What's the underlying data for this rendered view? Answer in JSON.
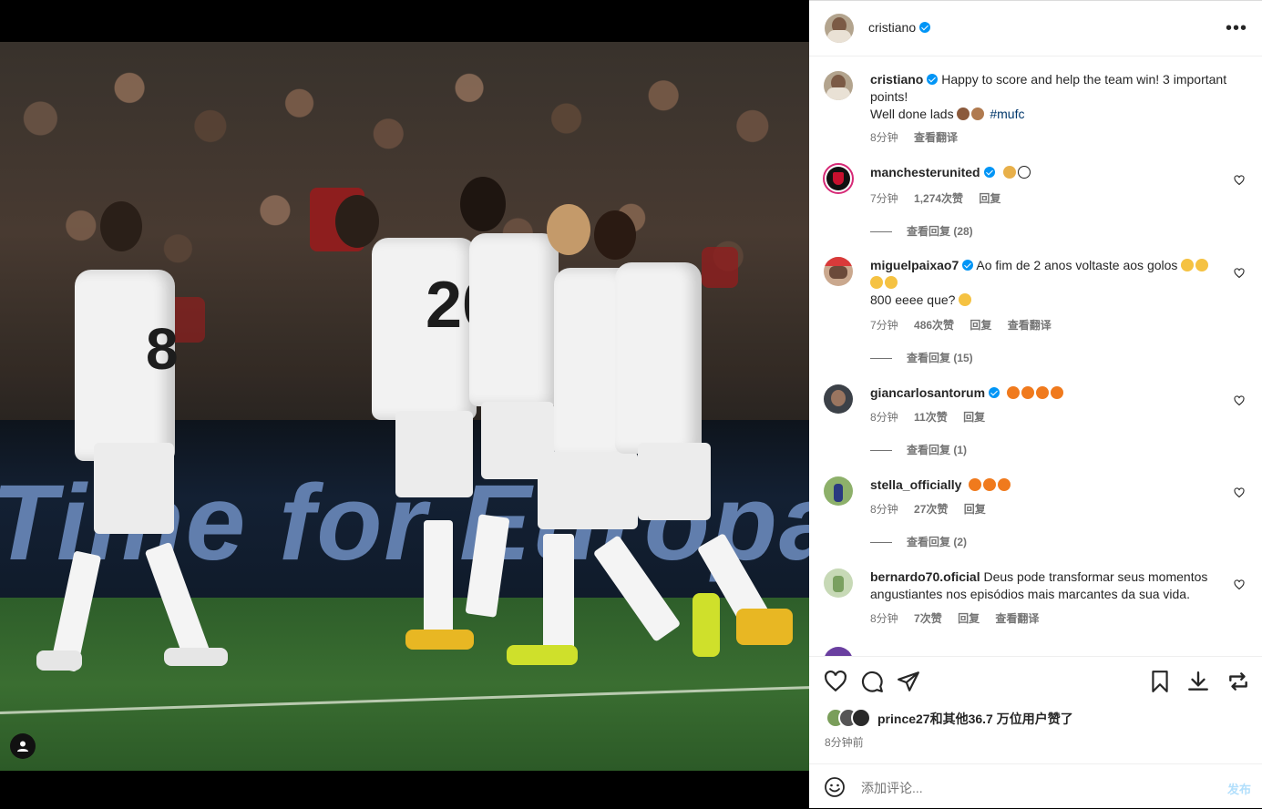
{
  "post": {
    "author": "cristiano",
    "caption_line1": "Happy to score and help the team win! 3 important points!",
    "caption_line2": "Well done lads",
    "caption_tag": "#mufc",
    "caption_time": "8分钟",
    "see_translation": "查看翻译"
  },
  "media": {
    "board_text": "Time for Europa"
  },
  "comments": [
    {
      "user": "manchesterunited",
      "text": "",
      "time": "7分钟",
      "likes": "1,274次赞",
      "reply": "回复",
      "translate": "",
      "view_replies": "查看回复 (28)"
    },
    {
      "user": "miguelpaixao7",
      "text": "Ao fim de 2 anos voltaste aos golos",
      "text2": "800 eeee que?",
      "time": "7分钟",
      "likes": "486次赞",
      "reply": "回复",
      "translate": "查看翻译",
      "view_replies": "查看回复 (15)"
    },
    {
      "user": "giancarlosantorum",
      "text": "",
      "time": "8分钟",
      "likes": "11次赞",
      "reply": "回复",
      "translate": "",
      "view_replies": "查看回复 (1)"
    },
    {
      "user": "stella_officially",
      "text": "",
      "time": "8分钟",
      "likes": "27次赞",
      "reply": "回复",
      "translate": "",
      "view_replies": "查看回复 (2)"
    },
    {
      "user": "bernardo70.oficial",
      "text": "Deus pode transformar seus momentos angustiantes nos episódios mais marcantes da sua vida.",
      "time": "8分钟",
      "likes": "7次赞",
      "reply": "回复",
      "translate": "查看翻译",
      "view_replies": ""
    }
  ],
  "likes_summary": "prince27和其他36.7 万位用户赞了",
  "post_time": "8分钟前",
  "add_comment": {
    "placeholder": "添加评论...",
    "post_label": "发布"
  },
  "colors": {
    "verified": "#0095f6",
    "link": "#00376b",
    "muted": "#737373",
    "post_button": "#b2dffc"
  }
}
